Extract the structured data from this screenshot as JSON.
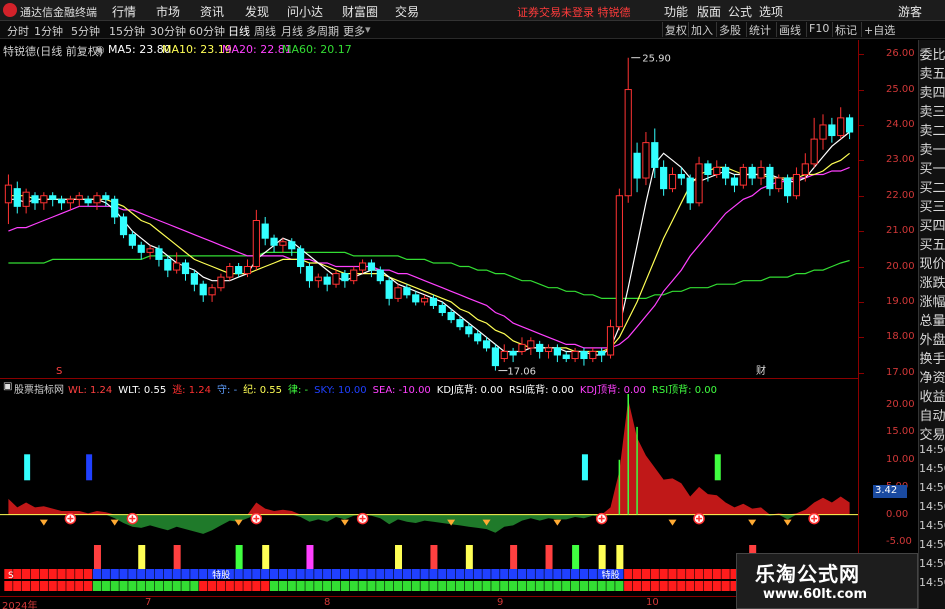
{
  "titlebar": {
    "app_title": "通达信金融终端",
    "menus": [
      "行情",
      "市场",
      "资讯",
      "发现",
      "问小达",
      "财富圈",
      "交易"
    ],
    "warning": "证券交易未登录  特锐德",
    "right_menus": [
      "功能",
      "版面",
      "公式",
      "选项"
    ],
    "guest": "游客"
  },
  "toolbar": {
    "periods": [
      "分时",
      "1分钟",
      "5分钟",
      "15分钟",
      "30分钟",
      "60分钟",
      "日线",
      "周线",
      "月线",
      "多周期",
      "更多"
    ],
    "active_period": "日线",
    "right_buttons": [
      "复权",
      "加入",
      "多股",
      "统计",
      "画线",
      "F10",
      "标记",
      "+自选"
    ]
  },
  "main_chart": {
    "stock_label": "特锐德(日线 前复权)",
    "ma": [
      {
        "name": "MA5",
        "value": "23.80",
        "color": "#ffffff"
      },
      {
        "name": "MA10",
        "value": "23.19",
        "color": "#ffff55"
      },
      {
        "name": "MA20",
        "value": "22.81",
        "color": "#ff40ff"
      },
      {
        "name": "MA60",
        "value": "20.17",
        "color": "#33dd33"
      }
    ],
    "high_marker": "25.90",
    "low_marker": "17.06",
    "marker_cai": "财",
    "marker_s": "S"
  },
  "chart_data": {
    "type": "candlestick",
    "y_ticks": [
      "26.00",
      "25.00",
      "24.00",
      "23.00",
      "22.00",
      "21.00",
      "20.00",
      "19.00",
      "18.00",
      "17.00"
    ],
    "ylim": [
      16.85,
      26.4
    ],
    "candles": [
      [
        21.8,
        22.3,
        21.2,
        22.6
      ],
      [
        22.2,
        21.7,
        21.5,
        22.4
      ],
      [
        21.7,
        22.1,
        21.5,
        22.2
      ],
      [
        22.0,
        21.8,
        21.6,
        22.1
      ],
      [
        21.8,
        22.0,
        21.6,
        22.1
      ],
      [
        22.0,
        21.9,
        21.7,
        22.1
      ],
      [
        21.9,
        21.8,
        21.6,
        22.0
      ],
      [
        21.8,
        21.9,
        21.6,
        22.0
      ],
      [
        21.9,
        22.0,
        21.7,
        22.1
      ],
      [
        21.9,
        21.8,
        21.7,
        22.0
      ],
      [
        21.8,
        22.0,
        21.6,
        22.1
      ],
      [
        22.0,
        21.9,
        21.7,
        22.1
      ],
      [
        21.9,
        21.4,
        21.2,
        22.0
      ],
      [
        21.4,
        20.9,
        20.8,
        21.5
      ],
      [
        20.9,
        20.6,
        20.5,
        21.0
      ],
      [
        20.6,
        20.4,
        20.2,
        20.7
      ],
      [
        20.4,
        20.5,
        20.2,
        20.6
      ],
      [
        20.5,
        20.2,
        20.0,
        20.6
      ],
      [
        20.2,
        19.9,
        19.7,
        20.3
      ],
      [
        19.9,
        20.1,
        19.8,
        20.4
      ],
      [
        20.1,
        19.8,
        19.6,
        20.2
      ],
      [
        19.8,
        19.5,
        19.3,
        19.9
      ],
      [
        19.5,
        19.2,
        19.0,
        19.6
      ],
      [
        19.2,
        19.4,
        19.0,
        19.5
      ],
      [
        19.4,
        19.7,
        19.3,
        19.8
      ],
      [
        19.7,
        20.0,
        19.6,
        20.1
      ],
      [
        20.0,
        19.8,
        19.7,
        20.1
      ],
      [
        19.8,
        20.0,
        19.7,
        20.2
      ],
      [
        20.0,
        21.3,
        19.9,
        21.6
      ],
      [
        21.2,
        20.8,
        20.6,
        21.4
      ],
      [
        20.8,
        20.6,
        20.4,
        20.9
      ],
      [
        20.6,
        20.7,
        20.4,
        20.8
      ],
      [
        20.7,
        20.5,
        20.3,
        20.8
      ],
      [
        20.5,
        20.0,
        19.8,
        20.6
      ],
      [
        20.0,
        19.6,
        19.4,
        20.1
      ],
      [
        19.6,
        19.7,
        19.4,
        19.8
      ],
      [
        19.7,
        19.5,
        19.3,
        19.8
      ],
      [
        19.5,
        19.8,
        19.4,
        19.9
      ],
      [
        19.8,
        19.6,
        19.4,
        19.9
      ],
      [
        19.6,
        19.9,
        19.5,
        20.0
      ],
      [
        19.9,
        20.1,
        19.8,
        20.2
      ],
      [
        20.1,
        19.9,
        19.7,
        20.2
      ],
      [
        19.9,
        19.6,
        19.5,
        20.0
      ],
      [
        19.6,
        19.1,
        18.9,
        19.7
      ],
      [
        19.1,
        19.4,
        19.0,
        19.5
      ],
      [
        19.4,
        19.2,
        19.1,
        19.5
      ],
      [
        19.2,
        19.0,
        18.9,
        19.3
      ],
      [
        19.0,
        19.1,
        18.9,
        19.2
      ],
      [
        19.1,
        18.9,
        18.8,
        19.2
      ],
      [
        18.9,
        18.7,
        18.6,
        19.0
      ],
      [
        18.7,
        18.5,
        18.4,
        18.8
      ],
      [
        18.5,
        18.3,
        18.2,
        18.6
      ],
      [
        18.3,
        18.1,
        18.0,
        18.4
      ],
      [
        18.1,
        17.9,
        17.8,
        18.2
      ],
      [
        17.9,
        17.7,
        17.6,
        18.0
      ],
      [
        17.7,
        17.2,
        17.06,
        17.8
      ],
      [
        17.4,
        17.6,
        17.3,
        17.8
      ],
      [
        17.6,
        17.5,
        17.3,
        17.7
      ],
      [
        17.6,
        17.8,
        17.5,
        18.0
      ],
      [
        17.7,
        17.9,
        17.5,
        18.0
      ],
      [
        17.8,
        17.6,
        17.4,
        17.9
      ],
      [
        17.6,
        17.7,
        17.4,
        17.8
      ],
      [
        17.7,
        17.5,
        17.3,
        17.8
      ],
      [
        17.5,
        17.4,
        17.3,
        17.6
      ],
      [
        17.4,
        17.6,
        17.3,
        17.7
      ],
      [
        17.6,
        17.4,
        17.2,
        17.7
      ],
      [
        17.4,
        17.6,
        17.3,
        17.7
      ],
      [
        17.6,
        17.5,
        17.3,
        17.7
      ],
      [
        17.5,
        18.3,
        17.4,
        18.5
      ],
      [
        18.3,
        22.0,
        18.2,
        22.2
      ],
      [
        22.0,
        25.0,
        21.8,
        25.9
      ],
      [
        23.2,
        22.5,
        22.1,
        23.5
      ],
      [
        22.5,
        23.5,
        22.3,
        23.8
      ],
      [
        23.5,
        22.8,
        22.5,
        23.9
      ],
      [
        22.8,
        22.2,
        22.0,
        23.0
      ],
      [
        22.2,
        22.6,
        22.1,
        22.8
      ],
      [
        22.6,
        22.5,
        22.3,
        22.8
      ],
      [
        22.5,
        21.8,
        21.6,
        22.6
      ],
      [
        21.8,
        22.9,
        21.7,
        23.1
      ],
      [
        22.9,
        22.6,
        22.4,
        23.0
      ],
      [
        22.6,
        22.8,
        22.5,
        23.0
      ],
      [
        22.8,
        22.5,
        22.3,
        22.9
      ],
      [
        22.5,
        22.3,
        22.1,
        22.6
      ],
      [
        22.3,
        22.8,
        22.2,
        22.9
      ],
      [
        22.8,
        22.5,
        22.3,
        22.9
      ],
      [
        22.5,
        22.8,
        22.3,
        23.0
      ],
      [
        22.8,
        22.2,
        22.0,
        22.9
      ],
      [
        22.2,
        22.5,
        22.1,
        22.6
      ],
      [
        22.5,
        22.0,
        21.8,
        22.6
      ],
      [
        22.0,
        22.6,
        21.9,
        22.8
      ],
      [
        22.6,
        22.9,
        22.4,
        23.2
      ],
      [
        22.9,
        23.6,
        22.8,
        24.2
      ],
      [
        23.6,
        24.0,
        23.3,
        24.3
      ],
      [
        24.0,
        23.7,
        23.5,
        24.2
      ],
      [
        23.7,
        24.2,
        23.6,
        24.5
      ],
      [
        24.2,
        23.8,
        23.6,
        24.3
      ]
    ],
    "ma5": [
      21.9,
      21.9,
      21.8,
      21.9,
      21.9,
      21.9,
      21.9,
      21.9,
      21.9,
      21.9,
      21.9,
      21.8,
      21.6,
      21.3,
      21.0,
      20.8,
      20.6,
      20.5,
      20.3,
      20.1,
      20.0,
      19.9,
      19.7,
      19.6,
      19.6,
      19.6,
      19.7,
      19.8,
      20.2,
      20.4,
      20.6,
      20.8,
      20.7,
      20.5,
      20.3,
      20.1,
      19.9,
      19.7,
      19.6,
      19.7,
      19.8,
      19.9,
      19.9,
      19.7,
      19.5,
      19.4,
      19.3,
      19.2,
      19.1,
      19.0,
      18.8,
      18.6,
      18.4,
      18.2,
      18.0,
      17.8,
      17.6,
      17.6,
      17.6,
      17.7,
      17.7,
      17.7,
      17.7,
      17.6,
      17.6,
      17.6,
      17.5,
      17.5,
      17.7,
      18.3,
      19.4,
      20.6,
      21.8,
      22.9,
      23.2,
      23.0,
      22.8,
      22.5,
      22.4,
      22.5,
      22.6,
      22.7,
      22.6,
      22.6,
      22.6,
      22.6,
      22.6,
      22.5,
      22.4,
      22.4,
      22.5,
      22.8,
      23.1,
      23.4,
      23.6,
      23.8
    ],
    "ma10": [
      22.0,
      22.0,
      22.0,
      21.9,
      21.9,
      21.9,
      21.9,
      21.9,
      21.9,
      21.9,
      21.9,
      21.9,
      21.8,
      21.7,
      21.5,
      21.3,
      21.2,
      21.0,
      20.8,
      20.6,
      20.4,
      20.2,
      20.1,
      20.0,
      19.9,
      19.8,
      19.8,
      19.8,
      19.9,
      20.0,
      20.1,
      20.2,
      20.2,
      20.2,
      20.1,
      20.1,
      20.0,
      19.9,
      19.8,
      19.8,
      19.8,
      19.8,
      19.8,
      19.7,
      19.6,
      19.5,
      19.4,
      19.3,
      19.2,
      19.1,
      19.0,
      18.8,
      18.7,
      18.5,
      18.4,
      18.2,
      18.1,
      17.9,
      17.8,
      17.7,
      17.7,
      17.7,
      17.7,
      17.7,
      17.6,
      17.6,
      17.6,
      17.6,
      17.7,
      18.0,
      18.5,
      19.0,
      19.6,
      20.2,
      20.8,
      21.3,
      21.8,
      22.3,
      22.6,
      22.7,
      22.8,
      22.8,
      22.7,
      22.6,
      22.6,
      22.6,
      22.5,
      22.5,
      22.5,
      22.5,
      22.6,
      22.6,
      22.7,
      22.9,
      23.0,
      23.2
    ],
    "ma20": [
      21.0,
      21.1,
      21.1,
      21.2,
      21.3,
      21.4,
      21.5,
      21.6,
      21.7,
      21.7,
      21.7,
      21.7,
      21.7,
      21.6,
      21.6,
      21.5,
      21.4,
      21.3,
      21.2,
      21.1,
      21.0,
      20.9,
      20.8,
      20.7,
      20.6,
      20.5,
      20.4,
      20.3,
      20.3,
      20.3,
      20.3,
      20.3,
      20.2,
      20.2,
      20.2,
      20.1,
      20.1,
      20.0,
      20.0,
      20.0,
      20.0,
      20.0,
      19.9,
      19.9,
      19.8,
      19.8,
      19.7,
      19.6,
      19.5,
      19.4,
      19.3,
      19.2,
      19.1,
      19.0,
      18.9,
      18.7,
      18.6,
      18.4,
      18.3,
      18.2,
      18.1,
      18.0,
      17.9,
      17.8,
      17.8,
      17.7,
      17.7,
      17.7,
      17.7,
      17.8,
      18.0,
      18.3,
      18.6,
      18.9,
      19.3,
      19.6,
      19.9,
      20.3,
      20.6,
      20.9,
      21.2,
      21.5,
      21.7,
      21.9,
      22.0,
      22.2,
      22.3,
      22.4,
      22.4,
      22.5,
      22.5,
      22.6,
      22.6,
      22.7,
      22.7,
      22.8
    ],
    "ma60": [
      20.1,
      20.1,
      20.1,
      20.1,
      20.1,
      20.2,
      20.2,
      20.2,
      20.2,
      20.2,
      20.2,
      20.2,
      20.2,
      20.2,
      20.2,
      20.2,
      20.3,
      20.3,
      20.3,
      20.3,
      20.3,
      20.3,
      20.3,
      20.3,
      20.3,
      20.3,
      20.3,
      20.3,
      20.3,
      20.4,
      20.4,
      20.4,
      20.4,
      20.4,
      20.4,
      20.4,
      20.4,
      20.4,
      20.4,
      20.3,
      20.3,
      20.3,
      20.3,
      20.3,
      20.3,
      20.2,
      20.2,
      20.2,
      20.1,
      20.1,
      20.1,
      20.0,
      20.0,
      19.9,
      19.9,
      19.8,
      19.8,
      19.7,
      19.6,
      19.6,
      19.5,
      19.4,
      19.4,
      19.3,
      19.3,
      19.2,
      19.2,
      19.1,
      19.1,
      19.1,
      19.1,
      19.1,
      19.1,
      19.2,
      19.2,
      19.3,
      19.3,
      19.4,
      19.4,
      19.4,
      19.5,
      19.5,
      19.5,
      19.6,
      19.6,
      19.6,
      19.7,
      19.7,
      19.7,
      19.8,
      19.8,
      19.9,
      19.9,
      20.0,
      20.1,
      20.17
    ]
  },
  "sub_chart": {
    "title": "股票指标网",
    "indicators": [
      {
        "name": "WL:",
        "value": "1.24",
        "color": "#ff4040"
      },
      {
        "name": "WLT:",
        "value": "0.55",
        "color": "#ffffff"
      },
      {
        "name": "逃:",
        "value": "1.24",
        "color": "#ff3030"
      },
      {
        "name": "守:",
        "value": "-",
        "color": "#5f9fff"
      },
      {
        "name": "纪:",
        "value": "0.55",
        "color": "#ffff55"
      },
      {
        "name": "律:",
        "value": "-",
        "color": "#40ff40"
      },
      {
        "name": "SKY:",
        "value": "10.00",
        "color": "#2040ff"
      },
      {
        "name": "SEA:",
        "value": "-10.00",
        "color": "#ff40ff"
      },
      {
        "name": "KDJ底背:",
        "value": "0.00",
        "color": "#ffffff"
      },
      {
        "name": "RSI底背:",
        "value": "0.00",
        "color": "#ffffff"
      },
      {
        "name": "KDJ顶背:",
        "value": "0.00",
        "color": "#ff40ff"
      },
      {
        "name": "RSI顶背:",
        "value": "0.00",
        "color": "#40ff40"
      }
    ],
    "y_ticks": [
      "20.00",
      "15.00",
      "10.00",
      "5.00",
      "0.00",
      "-5.00"
    ],
    "current_value": "3.42",
    "labels": [
      "S",
      "特股",
      "特股"
    ]
  },
  "date_axis": [
    "2024年",
    "7",
    "8",
    "9",
    "10"
  ],
  "side_panel": [
    "委比",
    "卖五",
    "卖四",
    "卖三",
    "卖二",
    "卖一",
    "买一",
    "买二",
    "买三",
    "买四",
    "买五",
    "现价",
    "涨跌",
    "涨幅",
    "总量",
    "外盘",
    "换手",
    "净资",
    "收益",
    "自动",
    "交易",
    "14:50",
    "14:50",
    "14:50",
    "14:50",
    "14:50",
    "14:50",
    "14:50",
    "14:50"
  ],
  "watermark": {
    "line1": "乐淘公式网",
    "line2": "www.60lt.com"
  },
  "colors": {
    "up": "#ff3333",
    "down": "#33ffff",
    "axis": "#8a0000",
    "bg": "#000000"
  }
}
